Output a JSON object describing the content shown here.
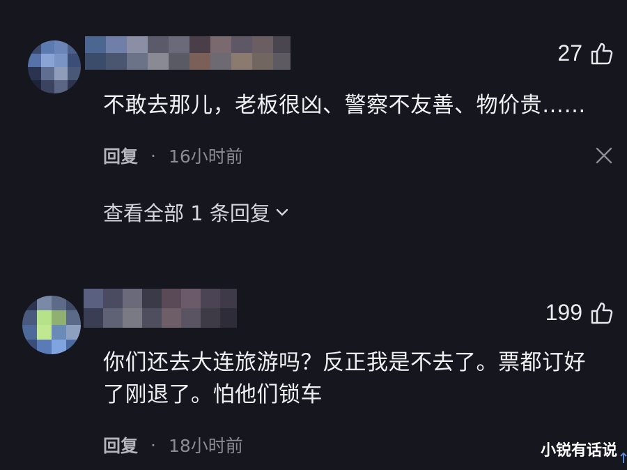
{
  "comments": [
    {
      "likes": "27",
      "text": "不敢去那儿，老板很凶、警察不友善、物价贵……",
      "reply_label": "回复",
      "separator": "·",
      "time": "16小时前",
      "view_replies": "查看全部 1 条回复"
    },
    {
      "likes": "199",
      "text_lines": [
        "你们还去大连旅游吗？反正我是不去了。票都订好",
        "了刚退了。怕他们锁车"
      ],
      "reply_label": "回复",
      "separator": "·",
      "time": "18小时前"
    }
  ],
  "watermark": "小锐有话说",
  "colors": {
    "background": "#16161e",
    "text": "#f0f0f3",
    "meta": "#8c8c94"
  },
  "icons": {
    "like": "thumbs-up-icon",
    "close": "close-icon",
    "expand": "chevron-down-icon"
  }
}
